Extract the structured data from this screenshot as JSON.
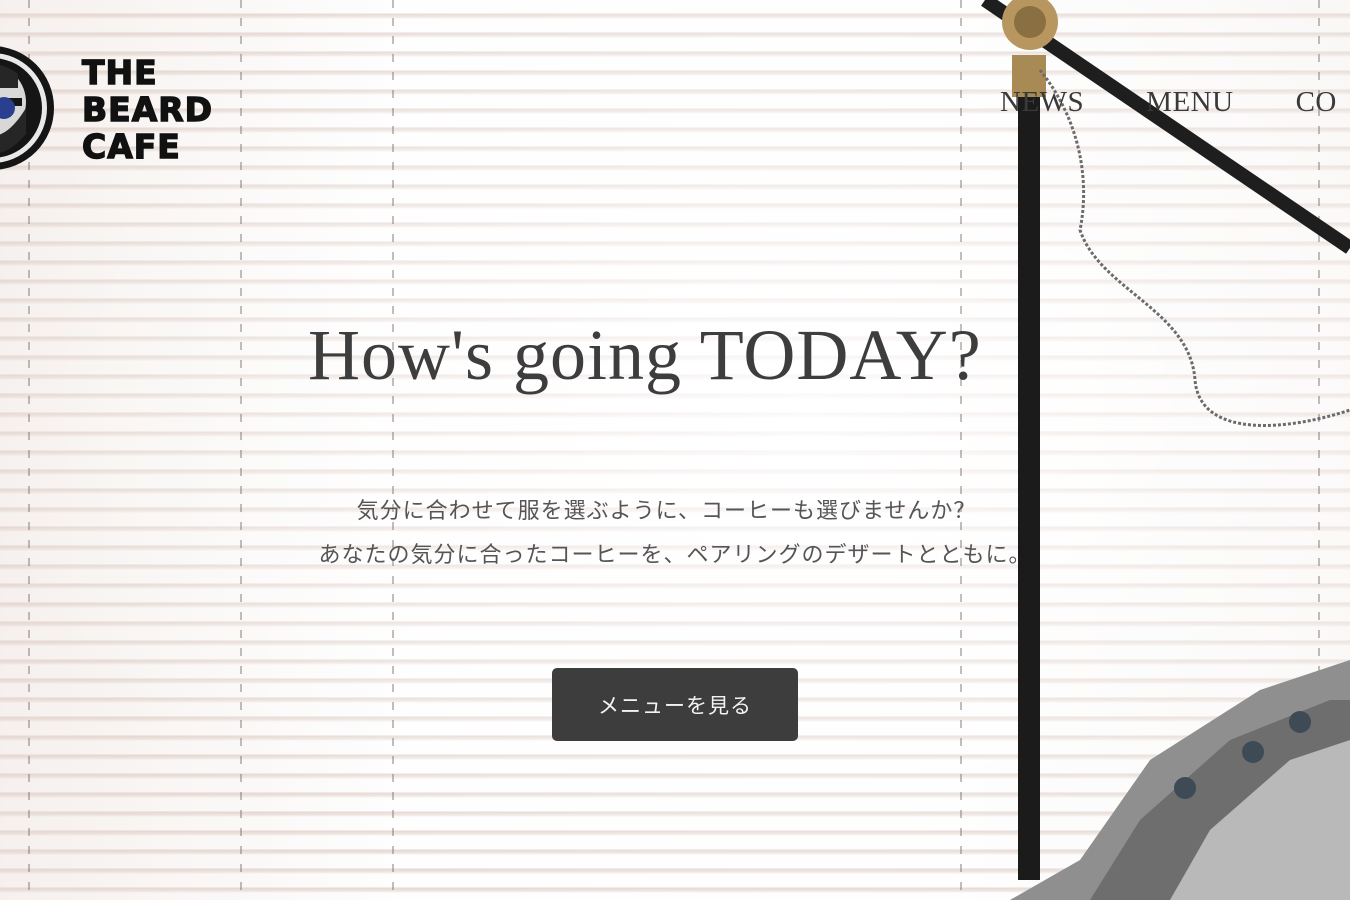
{
  "brand": {
    "name_lines": [
      "THE",
      "BEARD",
      "CAFE"
    ],
    "logo_icon": "bearded-man-with-sunglasses-icon"
  },
  "nav": {
    "items": [
      {
        "label": "NEWS"
      },
      {
        "label": "MENU"
      },
      {
        "label": "CO"
      }
    ]
  },
  "hero": {
    "title": "How's going TODAY?",
    "lead_line1": "気分に合わせて服を選ぶように、コーヒーも選びませんか？",
    "lead_line2": "あなたの気分に合ったコーヒーを、ペアリングのデザートとともに。",
    "cta_label": "メニューを見る"
  },
  "colors": {
    "text_dark": "#3d3d3d",
    "button_bg": "#3e3d3d",
    "button_text": "#f3f3f3",
    "logo_accent": "#2a3f8f"
  }
}
